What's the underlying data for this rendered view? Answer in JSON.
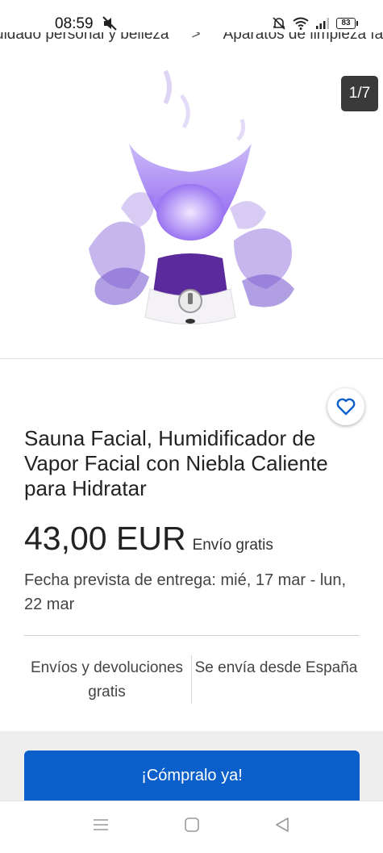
{
  "status_bar": {
    "time": "08:59",
    "battery": "83"
  },
  "breadcrumb": {
    "items": [
      "uidado personal y belleza",
      "Aparatos de limpieza facial"
    ],
    "separator": ">"
  },
  "gallery": {
    "counter": "1/7"
  },
  "product": {
    "title": " Sauna Facial,  Humidificador de Vapor Facial con Niebla Caliente para Hidratar",
    "price": "43,00 EUR",
    "shipping": "Envío gratis",
    "delivery": "Fecha prevista de entrega: mié, 17 mar - lun, 22 mar"
  },
  "info": {
    "left": "Envíos y devoluciones gratis",
    "right": "Se envía desde España"
  },
  "actions": {
    "buy_now": "¡Cómpralo ya!"
  },
  "colors": {
    "accent": "#0a5fca",
    "favorite": "#0a5fca",
    "product_purple": "#8a5cf0"
  }
}
